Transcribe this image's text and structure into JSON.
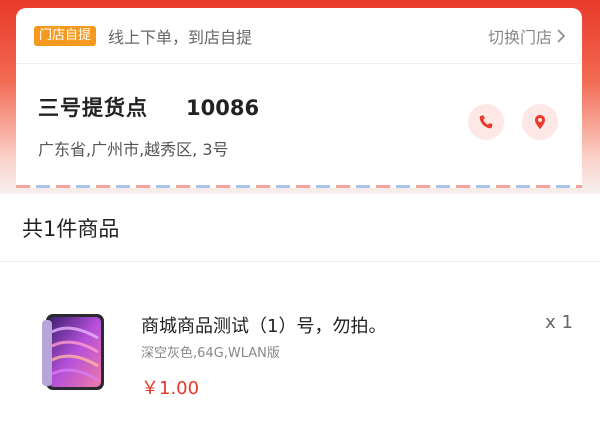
{
  "pickup": {
    "mode_tag": "门店自提",
    "mode_description": "线上下单，到店自提",
    "switch_store_label": "切换门店",
    "store_name": "三号提货点",
    "store_phone": "10086",
    "store_address": "广东省,广州市,越秀区, 3号",
    "call_icon": "phone-icon",
    "map_icon": "location-pin-icon"
  },
  "goods": {
    "count_label": "共1件商品",
    "items": [
      {
        "title": "商城商品测试（1）号，勿拍。",
        "spec": "深空灰色,64G,WLAN版",
        "price": "￥1.00",
        "quantity": "x 1",
        "image_icon": "tablet-product-image"
      }
    ]
  },
  "colors": {
    "brand_red": "#e8392b",
    "tag_orange": "#f59a1e",
    "icon_bg": "#fde8e6"
  }
}
